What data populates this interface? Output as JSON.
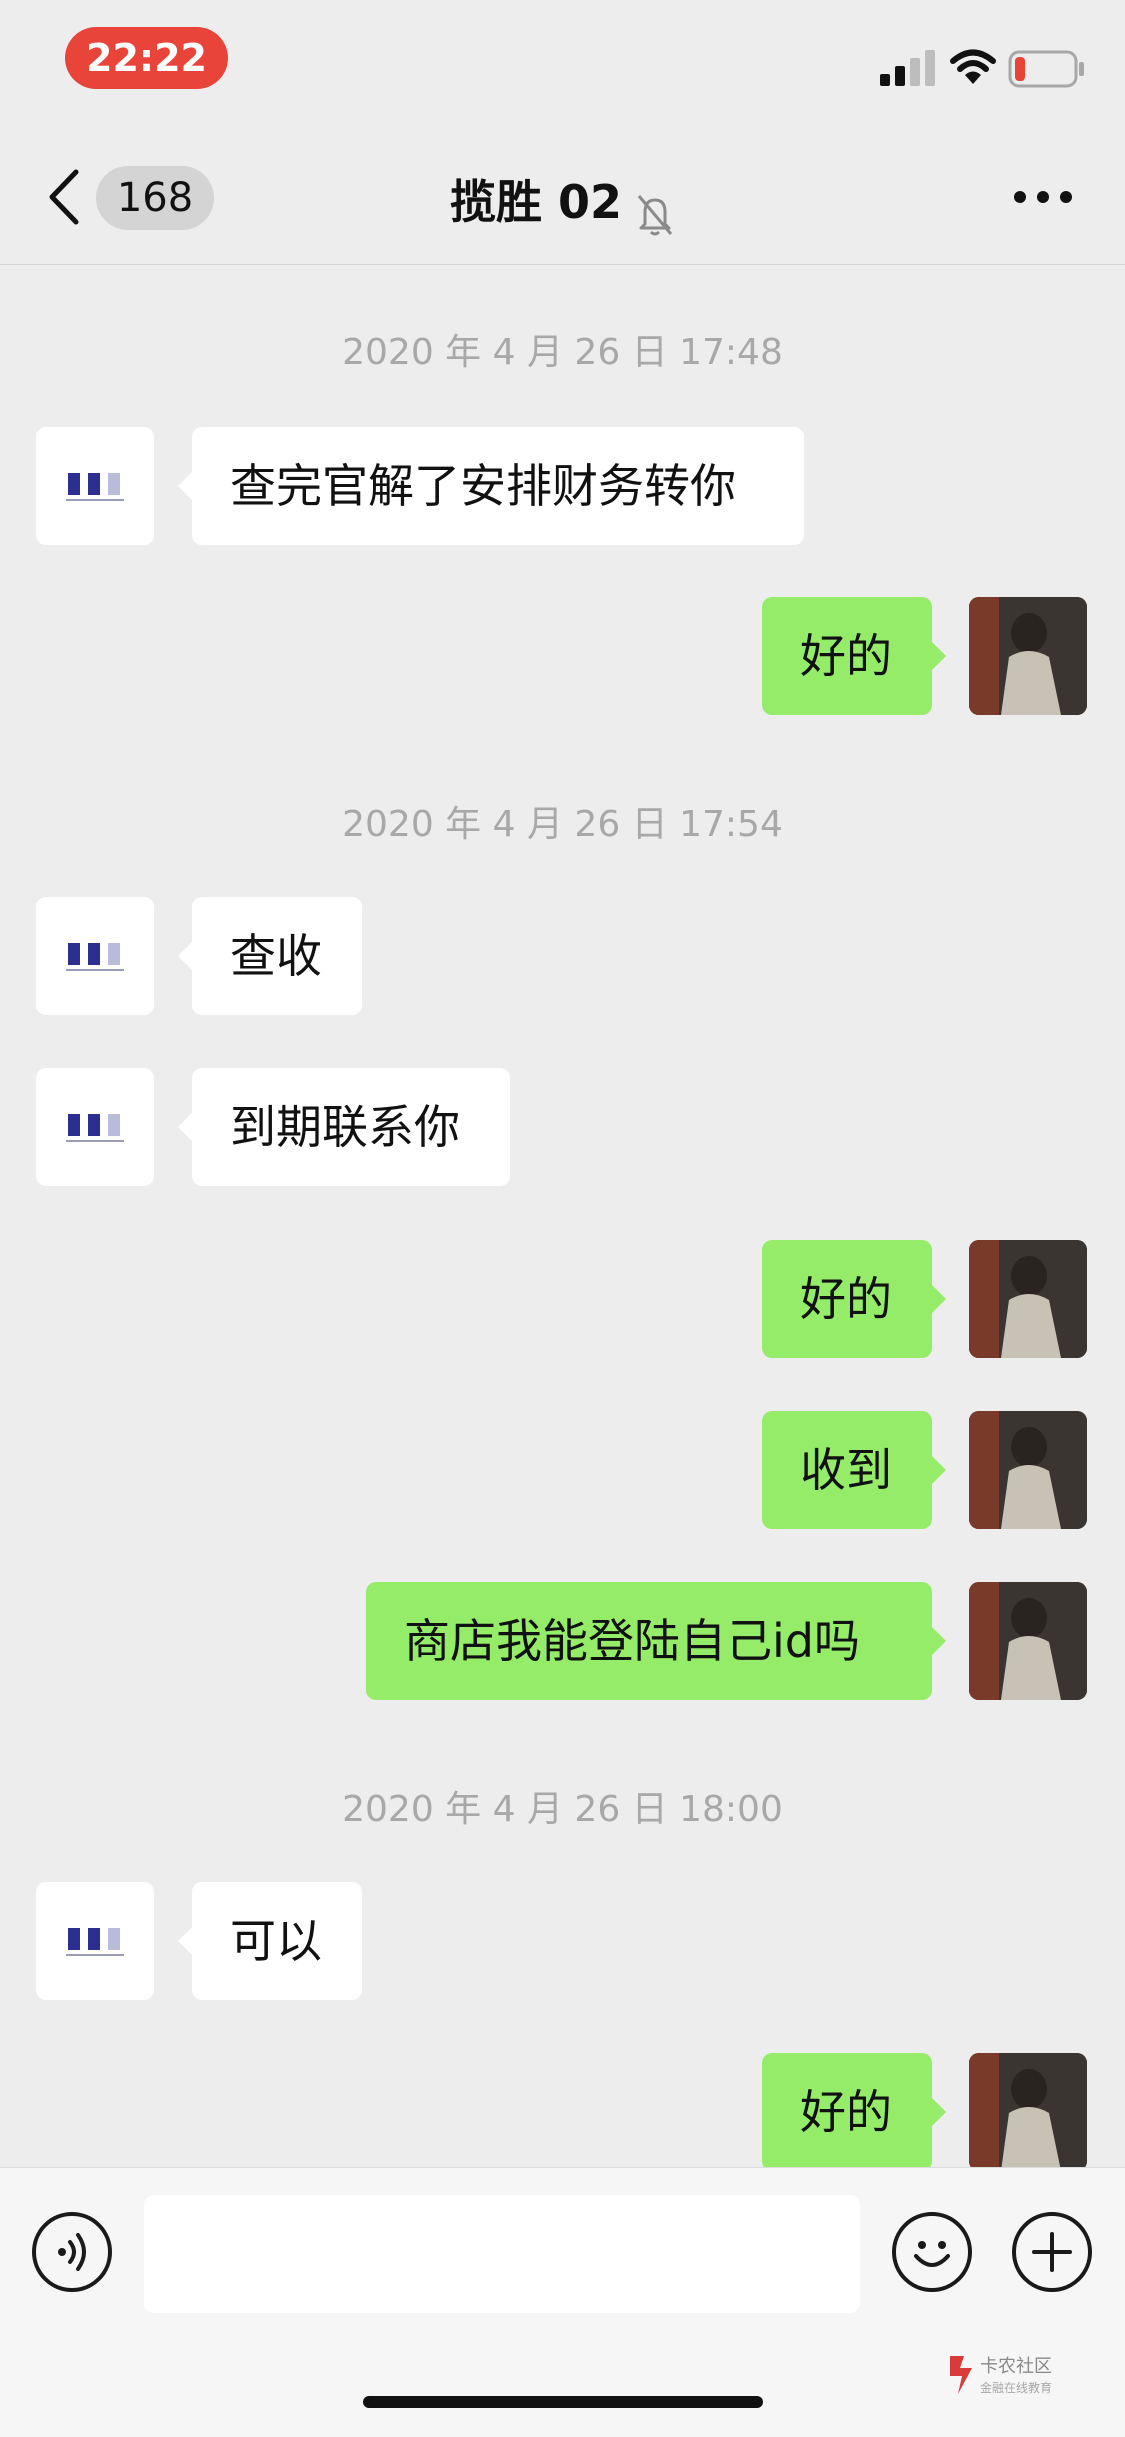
{
  "status_bar": {
    "time": "22:22",
    "battery_color": "#e8443a"
  },
  "nav": {
    "unread_count": "168",
    "title": "揽胜 02",
    "back_icon": "chevron-left-icon",
    "mute_icon": "bell-off-icon",
    "more_icon": "more-dots-icon"
  },
  "messages": [
    {
      "type": "timestamp",
      "text": "2020 年 4 月 26 日 17:48"
    },
    {
      "type": "in",
      "text": "查完官解了安排财务转你"
    },
    {
      "type": "out",
      "text": "好的"
    },
    {
      "type": "timestamp",
      "text": "2020 年 4 月 26 日 17:54"
    },
    {
      "type": "in",
      "text": "查收"
    },
    {
      "type": "in",
      "text": "到期联系你"
    },
    {
      "type": "out",
      "text": "好的"
    },
    {
      "type": "out",
      "text": "收到"
    },
    {
      "type": "out",
      "text": "商店我能登陆自己id吗"
    },
    {
      "type": "timestamp",
      "text": "2020 年 4 月 26 日 18:00"
    },
    {
      "type": "in",
      "text": "可以"
    },
    {
      "type": "out",
      "text": "好的"
    }
  ],
  "input_bar": {
    "voice_icon": "voice-icon",
    "emoji_icon": "emoji-icon",
    "plus_icon": "plus-icon",
    "text_value": ""
  },
  "watermark": {
    "logo_text": "卡农社区",
    "sub_text": "金融在线教育"
  },
  "colors": {
    "outgoing_bubble": "#95ec69",
    "incoming_bubble": "#ffffff",
    "chat_bg": "#ededed"
  }
}
